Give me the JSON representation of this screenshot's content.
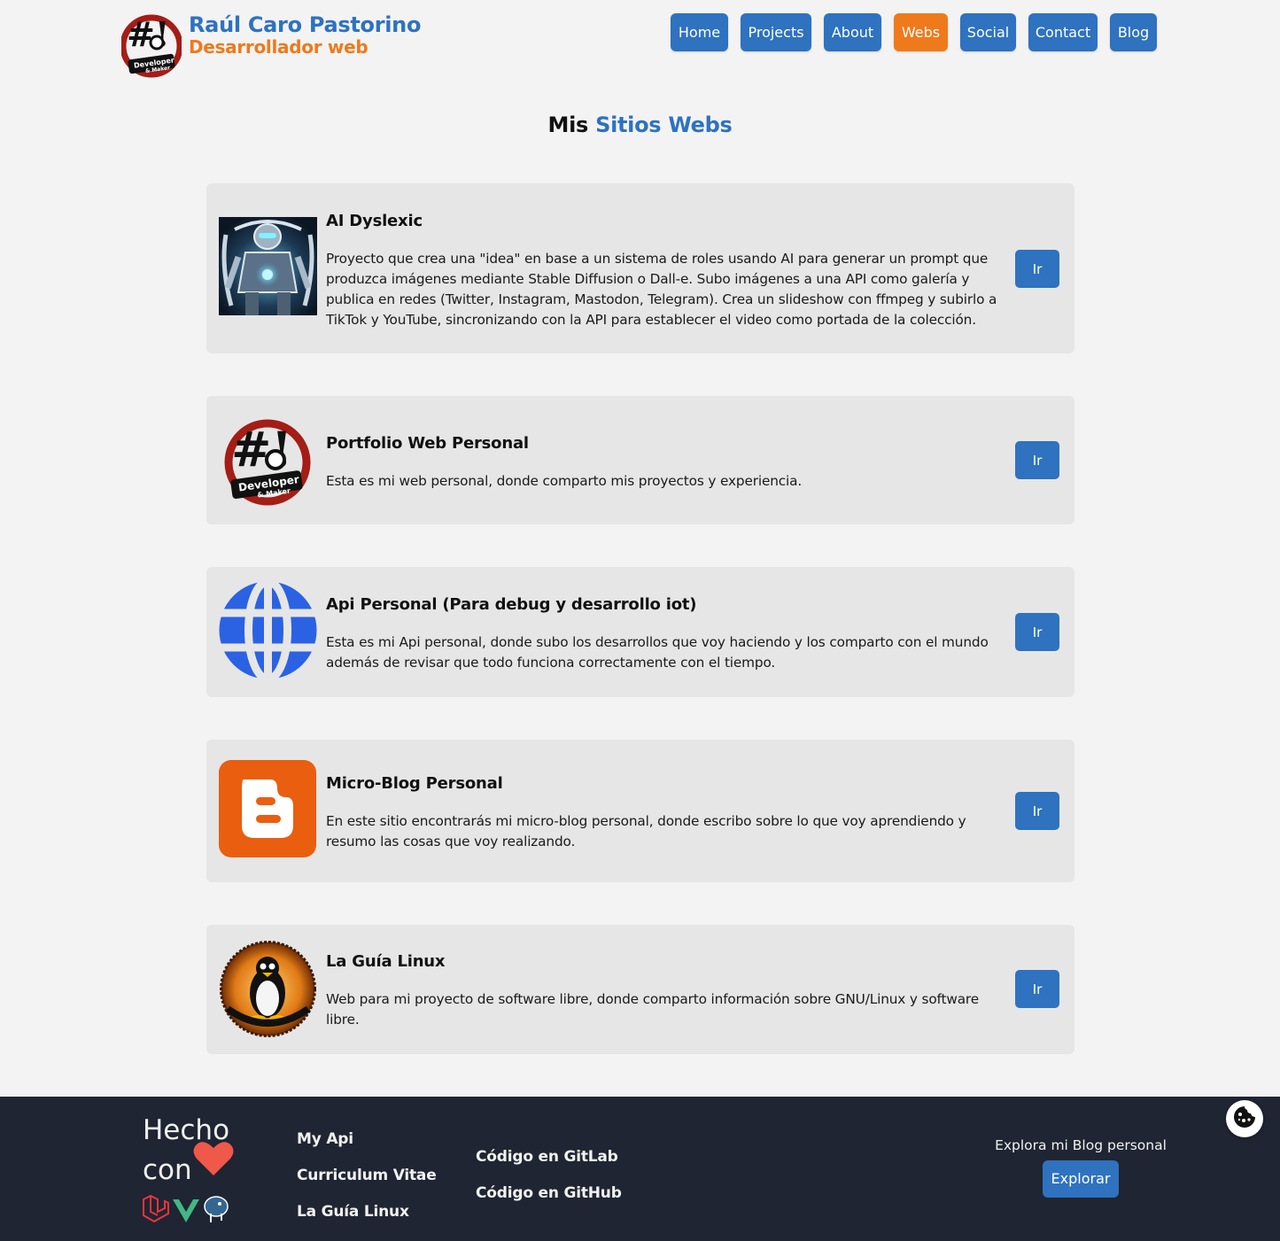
{
  "header": {
    "brand_name": "Raúl Caro Pastorino",
    "brand_role": "Desarrollador web",
    "nav": [
      {
        "label": "Home",
        "active": false
      },
      {
        "label": "Projects",
        "active": false
      },
      {
        "label": "About",
        "active": false
      },
      {
        "label": "Webs",
        "active": true
      },
      {
        "label": "Social",
        "active": false
      },
      {
        "label": "Contact",
        "active": false
      },
      {
        "label": "Blog",
        "active": false
      }
    ]
  },
  "page": {
    "title_prefix": "Mis",
    "title_accent": "Sitios Webs"
  },
  "sites": [
    {
      "title": "AI Dyslexic",
      "description": "Proyecto que crea una \"idea\" en base a un sistema de roles usando AI para generar un prompt que produzca imágenes mediante Stable Diffusion o Dall-e. Subo imágenes a una API como galería y publica en redes (Twitter, Instagram, Mastodon, Telegram). Crea un slideshow con ffmpeg y subirlo a TikTok y YouTube, sincronizando con la API para establecer el video como portada de la colección.",
      "button": "Ir",
      "icon": "robot-image"
    },
    {
      "title": "Portfolio Web Personal",
      "description": "Esta es mi web personal, donde comparto mis proyectos y experiencia.",
      "button": "Ir",
      "icon": "developer-maker-logo"
    },
    {
      "title": "Api Personal (Para debug y desarrollo iot)",
      "description": "Esta es mi Api personal, donde subo los desarrollos que voy haciendo y los comparto con el mundo además de revisar que todo funciona correctamente con el tiempo.",
      "button": "Ir",
      "icon": "globe-icon"
    },
    {
      "title": "Micro-Blog Personal",
      "description": "En este sitio encontrarás mi micro-blog personal, donde escribo sobre lo que voy aprendiendo y resumo las cosas que voy realizando.",
      "button": "Ir",
      "icon": "blogger-icon"
    },
    {
      "title": "La Guía Linux",
      "description": "Web para mi proyecto de software libre, donde comparto información sobre GNU/Linux y software libre.",
      "button": "Ir",
      "icon": "tux-logo"
    }
  ],
  "footer": {
    "made_with_line1": "Hecho",
    "made_with_line2": "con",
    "col1": [
      "My Api",
      "Curriculum Vitae",
      "La Guía Linux"
    ],
    "col2": [
      "Código en GitLab",
      "Código en GitHub"
    ],
    "explore_text": "Explora mi Blog personal",
    "explore_button": "Explorar"
  },
  "colors": {
    "primary": "#2e72c0",
    "accent": "#ee7a1c",
    "footer_bg": "#1f2532",
    "card_bg": "#e6e6e6",
    "page_bg": "#f3f3f3"
  }
}
